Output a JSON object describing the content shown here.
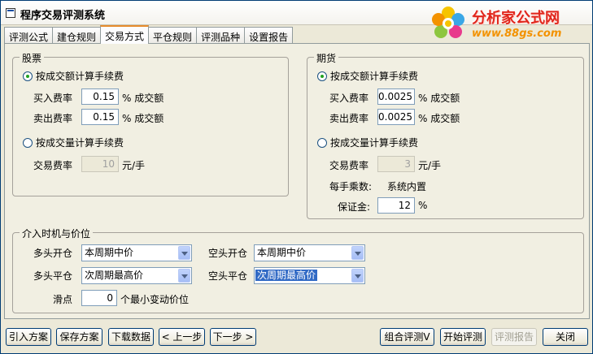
{
  "window": {
    "title": "程序交易评测系统"
  },
  "logo": {
    "brand": "分析家公式网",
    "url": "www.88gs.com"
  },
  "tabs": [
    "评测公式",
    "建仓规则",
    "交易方式",
    "平仓规则",
    "评测品种",
    "设置报告"
  ],
  "stocks": {
    "legend": "股票",
    "by_amount_label": "按成交额计算手续费",
    "buy_label": "买入费率",
    "buy_value": "0.15",
    "buy_unit": "% 成交额",
    "sell_label": "卖出费率",
    "sell_value": "0.15",
    "sell_unit": "% 成交额",
    "by_volume_label": "按成交量计算手续费",
    "trade_label": "交易费率",
    "trade_value": "10",
    "trade_unit": "元/手"
  },
  "futures": {
    "legend": "期货",
    "by_amount_label": "按成交额计算手续费",
    "buy_label": "买入费率",
    "buy_value": "0.0025",
    "buy_unit": "% 成交额",
    "sell_label": "卖出费率",
    "sell_value": "0.0025",
    "sell_unit": "% 成交额",
    "by_volume_label": "按成交量计算手续费",
    "trade_label": "交易费率",
    "trade_value": "3",
    "trade_unit": "元/手",
    "multiplier_label": "每手乘数:",
    "multiplier_value": "系统内置",
    "margin_label": "保证金:",
    "margin_value": "12",
    "margin_unit": "%"
  },
  "timing": {
    "legend": "介入时机与价位",
    "long_open_label": "多头开仓",
    "long_open_value": "本周期中价",
    "short_open_label": "空头开仓",
    "short_open_value": "本周期中价",
    "long_close_label": "多头平仓",
    "long_close_value": "次周期最高价",
    "short_close_label": "空头平仓",
    "short_close_value": "次周期最高价",
    "slippage_label": "滑点",
    "slippage_value": "0",
    "slippage_unit": "个最小变动价位"
  },
  "buttons": {
    "import": "引入方案",
    "save": "保存方案",
    "download": "下载数据",
    "prev": "< 上一步",
    "next": "下一步 >",
    "combo": "组合评测V",
    "start": "开始评测",
    "report": "评测报告",
    "close": "关闭"
  }
}
